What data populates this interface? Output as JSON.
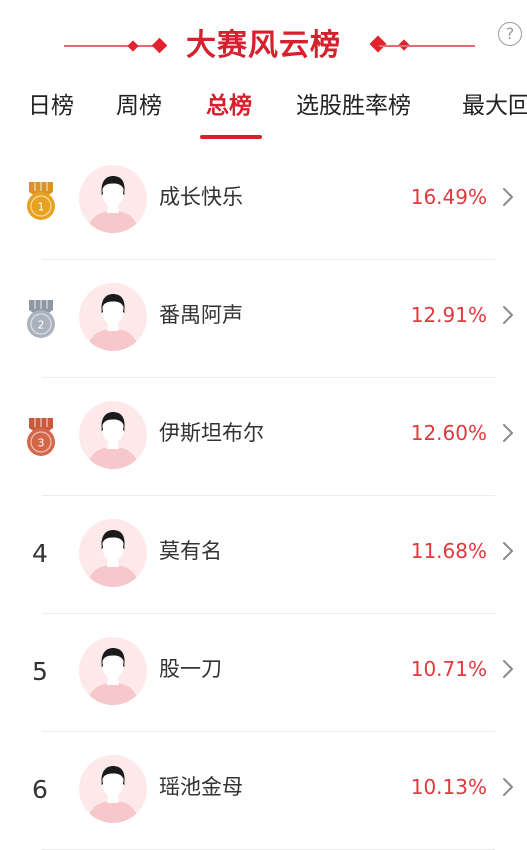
{
  "header": {
    "title": "大赛风云榜",
    "help_symbol": "?"
  },
  "tabs": [
    {
      "label": "日榜"
    },
    {
      "label": "周榜"
    },
    {
      "label": "总榜",
      "active": true
    },
    {
      "label": "选股胜率榜"
    },
    {
      "label": "最大回"
    }
  ],
  "rankings": [
    {
      "rank": "1",
      "medal": "gold",
      "name": "成长快乐",
      "percent": "16.49%"
    },
    {
      "rank": "2",
      "medal": "silver",
      "name": "番禺阿声",
      "percent": "12.91%"
    },
    {
      "rank": "3",
      "medal": "bronze",
      "name": "伊斯坦布尔",
      "percent": "12.60%"
    },
    {
      "rank": "4",
      "name": "莫有名",
      "percent": "11.68%"
    },
    {
      "rank": "5",
      "name": "股一刀",
      "percent": "10.71%"
    },
    {
      "rank": "6",
      "name": "瑶池金母",
      "percent": "10.13%"
    }
  ],
  "colors": {
    "accent": "#d7202e",
    "percent": "#e0393e",
    "gold": "#e7a21f",
    "silver": "#a9b2bd",
    "bronze": "#d4674a"
  }
}
